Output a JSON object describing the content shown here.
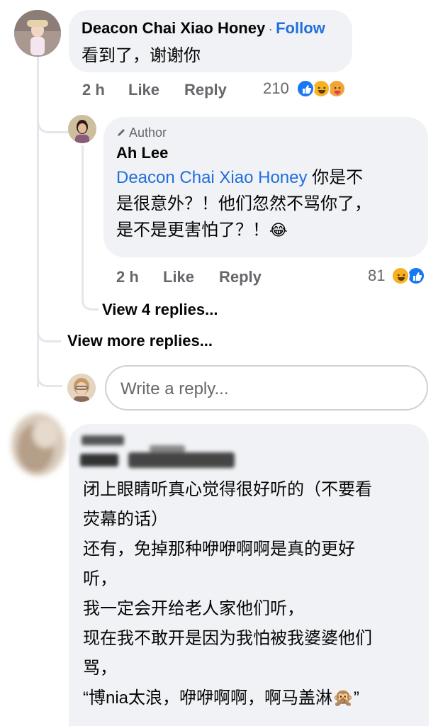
{
  "comment1": {
    "author": "Deacon Chai Xiao Honey",
    "follow": "Follow",
    "follow_sep": "·",
    "text": "看到了，谢谢你",
    "time": "2 h",
    "like": "Like",
    "reply": "Reply",
    "reaction_count": "210",
    "reactions": [
      "like-icon",
      "haha-icon",
      "care-icon"
    ]
  },
  "reply1": {
    "badge": "Author",
    "author": "Ah Lee",
    "mention": "Deacon Chai Xiao Honey",
    "text_line1": " 你是不",
    "text_line2": "是很意外？！他们忽然不骂你了，",
    "text_line3": "是不是更害怕了？！",
    "emoji": "😂",
    "time": "2 h",
    "like": "Like",
    "reply": "Reply",
    "reaction_count": "81",
    "reactions": [
      "haha-icon",
      "like-icon"
    ]
  },
  "view_replies": "View 4 replies...",
  "view_more": "View more replies...",
  "reply_input": {
    "placeholder": "Write a reply..."
  },
  "comment2": {
    "lines": [
      "闭上眼睛听真心觉得很好听的（不要看",
      "荧幕的话）",
      "还有，免掉那种咿咿啊啊是真的更好",
      "听，",
      "我一定会开给老人家他们听，",
      "现在我不敢开是因为我怕被我婆婆他们",
      "骂，",
      "“博nia太浪，咿咿啊啊，啊马盖淋🙊”"
    ]
  },
  "colors": {
    "bubble": "#f0f2f5",
    "link": "#216fdb",
    "meta": "#65676b",
    "like_blue": "#1877f2",
    "haha_yellow": "#f7b125"
  }
}
